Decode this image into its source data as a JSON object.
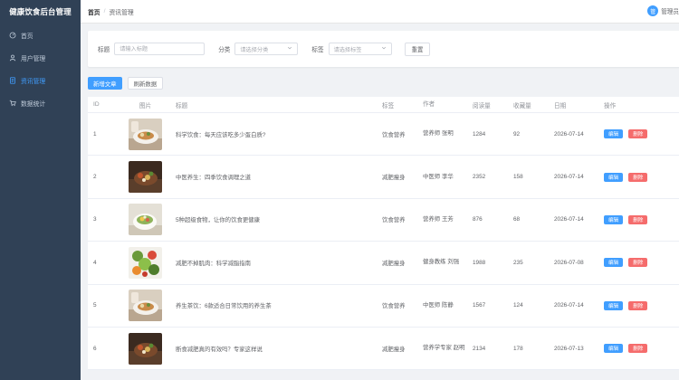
{
  "app": {
    "title": "健康饮食后台管理"
  },
  "sidebar": {
    "items": [
      {
        "label": "首页",
        "icon": "dashboard-icon",
        "active": false
      },
      {
        "label": "用户管理",
        "icon": "user-icon",
        "active": false
      },
      {
        "label": "资讯管理",
        "icon": "document-icon",
        "active": true
      },
      {
        "label": "数据统计",
        "icon": "cart-icon",
        "active": false
      }
    ]
  },
  "header": {
    "breadcrumb": [
      "首页",
      "资讯管理"
    ],
    "breadcrumb_sep": "/",
    "user": {
      "avatar_text": "管",
      "name": "管理员"
    }
  },
  "filter": {
    "title_label": "标题",
    "title_placeholder": "请输入标题",
    "category_label": "分类",
    "category_placeholder": "请选择分类",
    "tag_label": "标签",
    "tag_placeholder": "请选择标签",
    "reset_label": "重置"
  },
  "actions": {
    "add_label": "新增文章",
    "refresh_label": "刷新数据"
  },
  "table": {
    "columns": [
      "ID",
      "图片",
      "标题",
      "标签",
      "作者",
      "阅读量",
      "收藏量",
      "日期",
      "操作"
    ],
    "edit_label": "编辑",
    "delete_label": "删除",
    "rows": [
      {
        "id": "1",
        "title": "科学饮食：每天应该吃多少蛋白质?",
        "tag": "饮食营养",
        "author": "营养师 张明",
        "views": "1284",
        "favorites": "92",
        "date": "2026-07-14",
        "thumb": "plate-light"
      },
      {
        "id": "2",
        "title": "中医养生：四季饮食调理之道",
        "tag": "减肥瘦身",
        "author": "中医师 李华",
        "views": "2352",
        "favorites": "158",
        "date": "2026-07-14",
        "thumb": "plate-dark"
      },
      {
        "id": "3",
        "title": "5种超级食物，让你的饮食更健康",
        "tag": "饮食营养",
        "author": "营养师 王芳",
        "views": "876",
        "favorites": "68",
        "date": "2026-07-14",
        "thumb": "bowl-light"
      },
      {
        "id": "4",
        "title": "减肥不掉肌肉：科学减脂指南",
        "tag": "减肥瘦身",
        "author": "健身教练 刘强",
        "views": "1988",
        "favorites": "235",
        "date": "2026-07-08",
        "thumb": "veggies"
      },
      {
        "id": "5",
        "title": "养生茶饮：6款适合日常饮用的养生茶",
        "tag": "饮食营养",
        "author": "中医师 陈静",
        "views": "1567",
        "favorites": "124",
        "date": "2026-07-14",
        "thumb": "plate-light"
      },
      {
        "id": "6",
        "title": "断食减肥真的有效吗？专家这样说",
        "tag": "减肥瘦身",
        "author": "营养学专家 赵明",
        "views": "2134",
        "favorites": "178",
        "date": "2026-07-13",
        "thumb": "plate-dark"
      }
    ]
  },
  "colors": {
    "sidebar_bg": "#304156",
    "primary": "#409eff",
    "danger": "#f56c6c",
    "active_text": "#409eff"
  }
}
